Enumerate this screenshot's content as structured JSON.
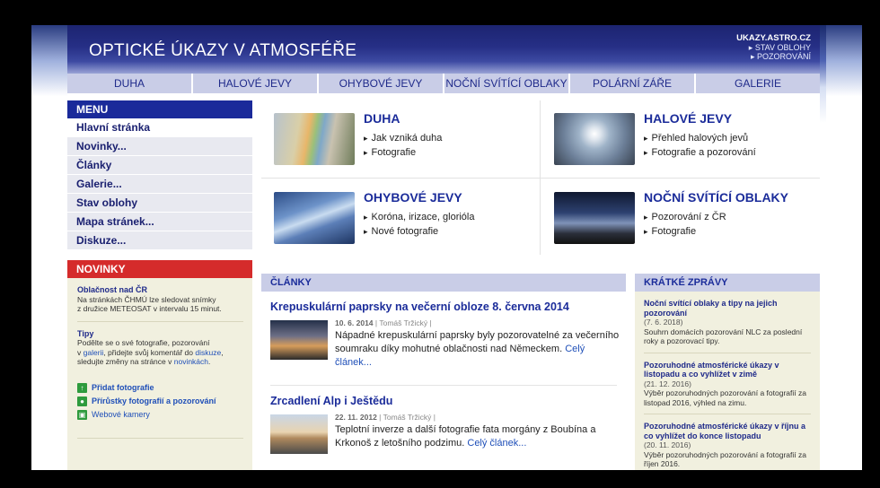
{
  "site": {
    "title": "OPTICKÉ ÚKAZY V ATMOSFÉŘE",
    "domain": "UKAZY.ASTRO.CZ",
    "top_links": [
      "▸ STAV OBLOHY",
      "▸ POZOROVÁNÍ"
    ]
  },
  "topnav": [
    "DUHA",
    "HALOVÉ JEVY",
    "OHYBOVÉ JEVY",
    "NOČNÍ SVÍTÍCÍ OBLAKY",
    "POLÁRNÍ ZÁŘE",
    "GALERIE"
  ],
  "menu": {
    "header": "MENU",
    "items": [
      "Hlavní stránka",
      "Novinky...",
      "Články",
      "Galerie...",
      "Stav oblohy",
      "Mapa stránek...",
      "Diskuze..."
    ]
  },
  "news": {
    "header": "NOVINKY",
    "item1": {
      "title": "Oblačnost nad ČR",
      "line1": "Na stránkách ČHMÚ lze sledovat snímky",
      "line2": "z družice METEOSAT v intervalu 15 minut."
    },
    "item2": {
      "title": "Tipy",
      "line1": "Podělte se o své fotografie, pozorování",
      "line2a": "v ",
      "link1": "galerii",
      "line2b": ", přidejte svůj komentář do ",
      "link2": "diskuze",
      "line2c": ",",
      "line3a": "sledujte změny na stránce v ",
      "link3": "novinkách",
      "line3b": "."
    },
    "quick_links": [
      "Přidat fotografie",
      "Přírůstky fotografií a pozorování",
      "Webové kamery"
    ]
  },
  "tiles": [
    {
      "title": "DUHA",
      "links": [
        "Jak vzniká duha",
        "Fotografie"
      ]
    },
    {
      "title": "HALOVÉ JEVY",
      "links": [
        "Přehled halových jevů",
        "Fotografie a pozorování"
      ]
    },
    {
      "title": "OHYBOVÉ JEVY",
      "links": [
        "Koróna, irizace, glorióla",
        "Nové fotografie"
      ]
    },
    {
      "title": "NOČNÍ SVÍTÍCÍ OBLAKY",
      "links": [
        "Pozorování z ČR",
        "Fotografie"
      ]
    }
  ],
  "articles": {
    "header": "ČLÁNKY",
    "items": [
      {
        "title": "Krepuskulární paprsky na večerní obloze 8. června 2014",
        "date": "10. 6. 2014",
        "author": "| Tomáš Tržický |",
        "text": "Nápadné krepuskulární paprsky byly pozorovatelné za večerního soumraku díky mohutné oblačnosti nad Německem.",
        "more": "Celý článek..."
      },
      {
        "title": "Zrcadlení Alp i Ještědu",
        "date": "22. 11. 2012",
        "author": "| Tomáš Tržický |",
        "text": "Teplotní inverze a další fotografie fata morgány z Boubína a Krkonoš z letošního podzimu.",
        "more": "Celý článek..."
      }
    ]
  },
  "short_news": {
    "header": "KRÁTKÉ ZPRÁVY",
    "items": [
      {
        "title": "Noční svítící oblaky a tipy na jejich pozorování",
        "date": "(7. 6. 2018)",
        "text": "Souhrn domácích pozorování NLC za poslední roky a pozorovací tipy."
      },
      {
        "title": "Pozoruhodné atmosférické úkazy v listopadu a co vyhlížet v zimě",
        "date": "(21. 12. 2016)",
        "text": "Výběr pozoruhodných pozorování a fotografií za listopad 2016, výhled na zimu."
      },
      {
        "title": "Pozoruhodné atmosférické úkazy v říjnu a co vyhlížet do konce listopadu",
        "date": "(20. 11. 2016)",
        "text": "Výběr pozoruhodných pozorování a fotografií za říjen 2016."
      }
    ]
  },
  "colors": {
    "banner": "#262f86",
    "nav_bg": "#c9cde7",
    "menu_head": "#1a2a9a",
    "news_head": "#d52b2b",
    "link": "#1b2c9a",
    "panel_bg": "#f1f0df"
  }
}
